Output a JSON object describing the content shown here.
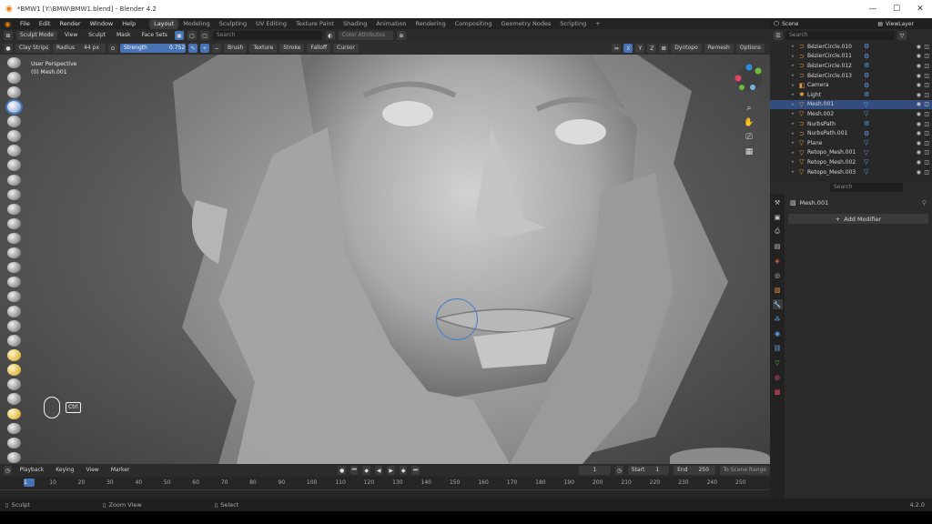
{
  "window": {
    "title": "*BMW1 [Y:\\BMW\\BMW1.blend] - Blender 4.2",
    "controls": [
      "—",
      "☐",
      "✕"
    ]
  },
  "menubar": {
    "menus": [
      "File",
      "Edit",
      "Render",
      "Window",
      "Help"
    ],
    "workspaces": [
      {
        "label": "Layout",
        "active": true
      },
      {
        "label": "Modeling",
        "active": false
      },
      {
        "label": "Sculpting",
        "active": false
      },
      {
        "label": "UV Editing",
        "active": false
      },
      {
        "label": "Texture Paint",
        "active": false
      },
      {
        "label": "Shading",
        "active": false
      },
      {
        "label": "Animation",
        "active": false
      },
      {
        "label": "Rendering",
        "active": false
      },
      {
        "label": "Compositing",
        "active": false
      },
      {
        "label": "Geometry Nodes",
        "active": false
      },
      {
        "label": "Scripting",
        "active": false
      }
    ],
    "scene": "Scene",
    "view_layer": "ViewLayer"
  },
  "viewport_header": {
    "mode": "Sculpt Mode",
    "menus": [
      "View",
      "Sculpt",
      "Mask",
      "Face Sets"
    ],
    "search_placeholder": "Search",
    "color_attributes": "Color Attributes",
    "axes": [
      "X",
      "Y",
      "Z"
    ],
    "dyntopo": "Dyntopo",
    "remesh": "Remesh",
    "options": "Options"
  },
  "tool_settings": {
    "brush_name": "Clay Strips",
    "radius_label": "Radius",
    "radius_value": "44 px",
    "strength_label": "Strength",
    "strength_value": "0.752",
    "dropdowns": [
      "Brush",
      "Texture",
      "Stroke",
      "Falloff",
      "Cursor"
    ]
  },
  "viewport": {
    "overlay_line1": "User Perspective",
    "overlay_line2": "(0) Mesh.001",
    "key_hint": "Ctrl"
  },
  "outliner": {
    "search_placeholder": "Search",
    "items": [
      {
        "name": "BézierCircle.010",
        "icon": "curve-icon",
        "selected": false
      },
      {
        "name": "BézierCircle.011",
        "icon": "curve-icon",
        "selected": false
      },
      {
        "name": "BézierCircle.012",
        "icon": "curve-icon",
        "selected": false
      },
      {
        "name": "BézierCircle.013",
        "icon": "curve-icon",
        "selected": false
      },
      {
        "name": "Camera",
        "icon": "camera-icon",
        "selected": false
      },
      {
        "name": "Light",
        "icon": "light-icon",
        "selected": false
      },
      {
        "name": "Mesh.001",
        "icon": "mesh-icon",
        "selected": true
      },
      {
        "name": "Mesh.002",
        "icon": "mesh-icon",
        "selected": false
      },
      {
        "name": "NurbsPath",
        "icon": "curve-icon",
        "selected": false
      },
      {
        "name": "NurbsPath.001",
        "icon": "curve-icon",
        "selected": false
      },
      {
        "name": "Plane",
        "icon": "mesh-icon",
        "selected": false
      },
      {
        "name": "Retopo_Mesh.001",
        "icon": "mesh-icon",
        "selected": false
      },
      {
        "name": "Retopo_Mesh.002",
        "icon": "mesh-icon",
        "selected": false
      },
      {
        "name": "Retopo_Mesh.003",
        "icon": "mesh-icon",
        "selected": false
      }
    ]
  },
  "properties": {
    "search_placeholder": "Search",
    "object_name": "Mesh.001",
    "add_modifier": "Add Modifier"
  },
  "timeline": {
    "menus": [
      "Playback",
      "Keying",
      "View",
      "Marker"
    ],
    "current_frame": "1",
    "start_label": "Start",
    "start_value": "1",
    "end_label": "End",
    "end_value": "250",
    "scene_range": "To Scene Range",
    "ticks": [
      "1",
      "10",
      "20",
      "30",
      "40",
      "50",
      "60",
      "70",
      "80",
      "90",
      "100",
      "110",
      "120",
      "130",
      "140",
      "150",
      "160",
      "170",
      "180",
      "190",
      "200",
      "210",
      "220",
      "230",
      "240",
      "250"
    ]
  },
  "statusbar": {
    "left": "Sculpt",
    "middle": "Zoom View",
    "right": "Select",
    "version": "4.2.0"
  },
  "colors": {
    "accent": "#4772b3",
    "blender_orange": "#e87d0d",
    "selected_row": "#334d80"
  }
}
